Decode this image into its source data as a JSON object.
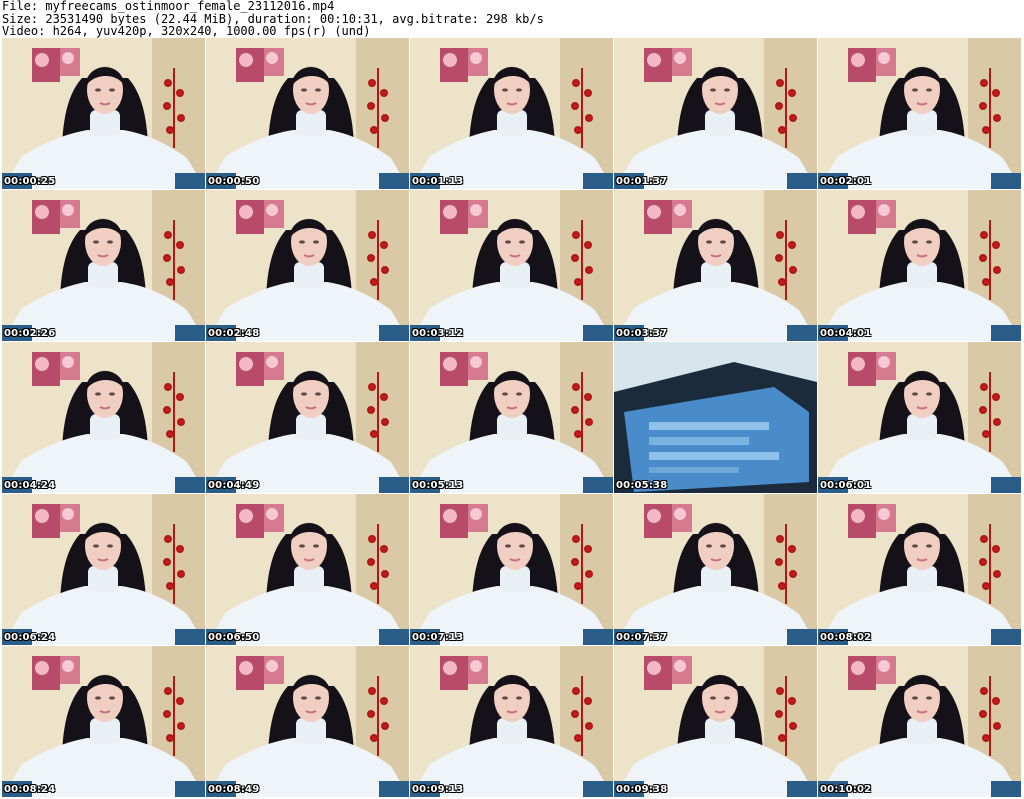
{
  "header": {
    "file_line": "File: myfreecams_ostinmoor_female_23112016.mp4",
    "size_line": "Size: 23531490 bytes (22.44 MiB), duration: 00:10:31, avg.bitrate: 298 kb/s",
    "video_line": "Video: h264, yuv420p, 320x240, 1000.00 fps(r) (und)"
  },
  "thumbnails": [
    {
      "time": "00:00:25",
      "scene": "person"
    },
    {
      "time": "00:00:50",
      "scene": "person"
    },
    {
      "time": "00:01:13",
      "scene": "person"
    },
    {
      "time": "00:01:37",
      "scene": "person"
    },
    {
      "time": "00:02:01",
      "scene": "person"
    },
    {
      "time": "00:02:26",
      "scene": "person"
    },
    {
      "time": "00:02:48",
      "scene": "person"
    },
    {
      "time": "00:03:12",
      "scene": "person"
    },
    {
      "time": "00:03:37",
      "scene": "person"
    },
    {
      "time": "00:04:01",
      "scene": "person"
    },
    {
      "time": "00:04:24",
      "scene": "person"
    },
    {
      "time": "00:04:49",
      "scene": "person"
    },
    {
      "time": "00:05:13",
      "scene": "person"
    },
    {
      "time": "00:05:38",
      "scene": "screen"
    },
    {
      "time": "00:06:01",
      "scene": "person"
    },
    {
      "time": "00:06:24",
      "scene": "person"
    },
    {
      "time": "00:06:50",
      "scene": "person"
    },
    {
      "time": "00:07:13",
      "scene": "person"
    },
    {
      "time": "00:07:37",
      "scene": "person"
    },
    {
      "time": "00:08:02",
      "scene": "person"
    },
    {
      "time": "00:08:24",
      "scene": "person"
    },
    {
      "time": "00:08:49",
      "scene": "person"
    },
    {
      "time": "00:09:13",
      "scene": "person"
    },
    {
      "time": "00:09:38",
      "scene": "person"
    },
    {
      "time": "00:10:02",
      "scene": "person"
    }
  ]
}
